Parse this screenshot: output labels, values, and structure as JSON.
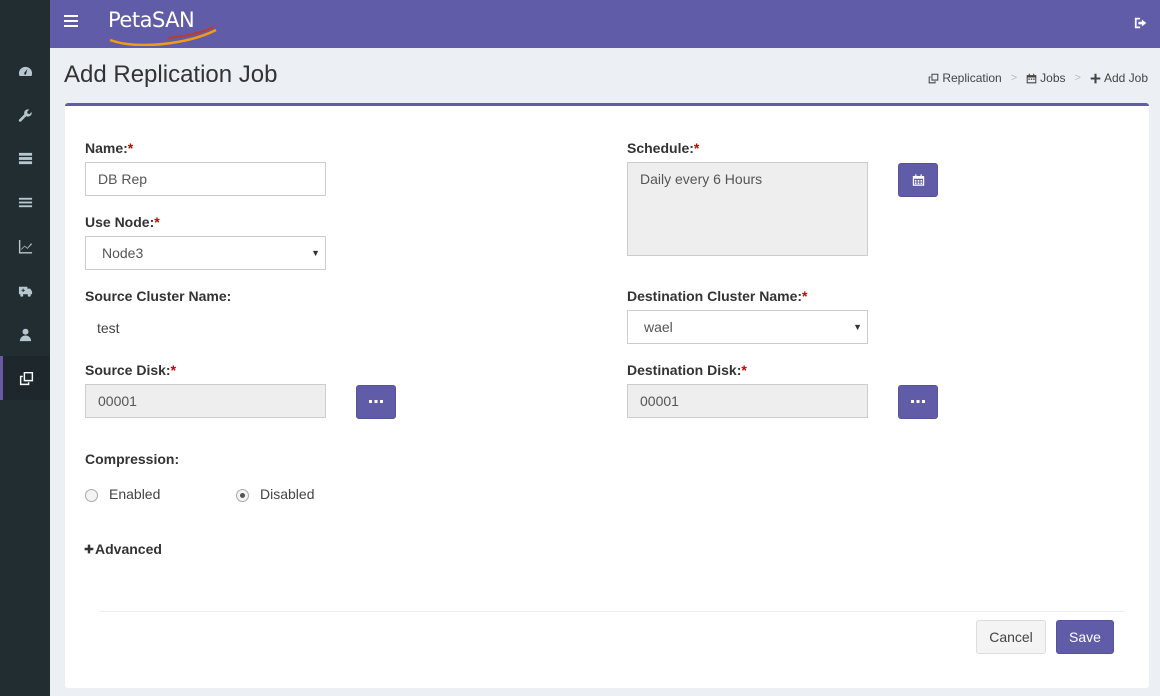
{
  "app": {
    "logo_text": "PetaSAN",
    "brand_color": "#605ca8",
    "sidebar_color": "#222d32"
  },
  "sidebar": {
    "items": [
      {
        "icon": "dashboard-icon"
      },
      {
        "icon": "wrench-icon"
      },
      {
        "icon": "server-icon"
      },
      {
        "icon": "list-icon"
      },
      {
        "icon": "line-chart-icon"
      },
      {
        "icon": "ambulance-icon"
      },
      {
        "icon": "user-icon"
      },
      {
        "icon": "clone-icon",
        "active": true
      }
    ]
  },
  "page": {
    "title": "Add Replication Job"
  },
  "breadcrumb": {
    "replication": "Replication",
    "jobs": "Jobs",
    "add_job": "Add Job"
  },
  "form": {
    "name": {
      "label": "Name:",
      "value": "DB Rep"
    },
    "use_node": {
      "label": "Use Node:",
      "value": "Node3"
    },
    "source_cluster": {
      "label": "Source Cluster Name:",
      "value": "test"
    },
    "source_disk": {
      "label": "Source Disk:",
      "value": "00001"
    },
    "schedule": {
      "label": "Schedule:",
      "value": "Daily every 6 Hours"
    },
    "dest_cluster": {
      "label": "Destination Cluster Name:",
      "value": "wael"
    },
    "dest_disk": {
      "label": "Destination Disk:",
      "value": "00001"
    },
    "compression": {
      "label": "Compression:",
      "enabled_label": "Enabled",
      "disabled_label": "Disabled",
      "selected": "Disabled"
    },
    "advanced_label": "Advanced",
    "required_mark": "*"
  },
  "actions": {
    "cancel": "Cancel",
    "save": "Save"
  }
}
